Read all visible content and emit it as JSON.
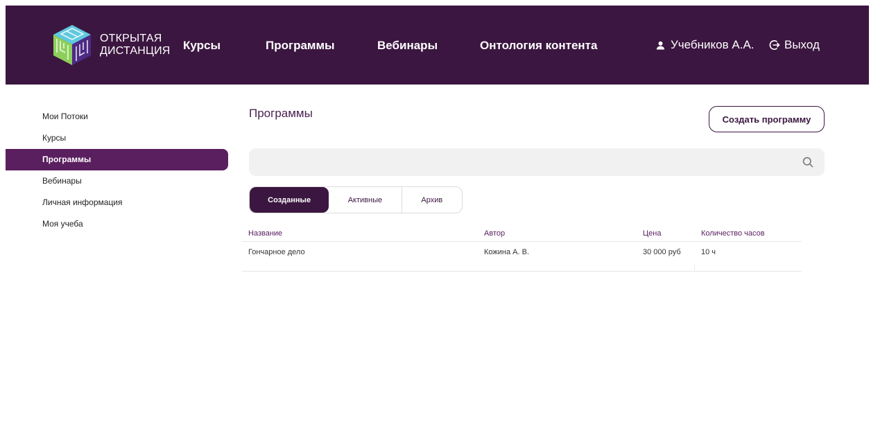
{
  "header": {
    "logo": {
      "line1": "ОТКРЫТАЯ",
      "line2": "ДИСТАНЦИЯ"
    },
    "nav": [
      {
        "label": "Курсы"
      },
      {
        "label": "Программы"
      },
      {
        "label": "Вебинары"
      },
      {
        "label": "Онтология контента"
      }
    ],
    "user_name": "Учебников А.А.",
    "logout_label": "Выход"
  },
  "sidebar": {
    "items": [
      {
        "label": "Мои Потоки",
        "active": false
      },
      {
        "label": "Курсы",
        "active": false
      },
      {
        "label": "Программы",
        "active": true
      },
      {
        "label": "Вебинары",
        "active": false
      },
      {
        "label": "Личная информация",
        "active": false
      },
      {
        "label": "Моя учеба",
        "active": false
      }
    ]
  },
  "main": {
    "title": "Программы",
    "create_button": "Создать программу",
    "search": {
      "value": "",
      "placeholder": ""
    },
    "tabs": [
      {
        "label": "Созданные",
        "active": true
      },
      {
        "label": "Активные",
        "active": false
      },
      {
        "label": "Архив",
        "active": false
      }
    ],
    "table": {
      "columns": [
        "Название",
        "Автор",
        "Цена",
        "Количество часов"
      ],
      "rows": [
        {
          "name": "Гончарное дело",
          "author": "Кожина А. В.",
          "price": "30 000 руб",
          "hours": "10 ч"
        }
      ]
    }
  },
  "colors": {
    "header_bg": "#3b1640",
    "accent": "#5a1f5f",
    "search_bg": "#f1f1f1"
  },
  "icons": {
    "user": "user-icon",
    "logout": "logout-icon",
    "search": "search-icon",
    "logo": "logo-cube-icon"
  }
}
